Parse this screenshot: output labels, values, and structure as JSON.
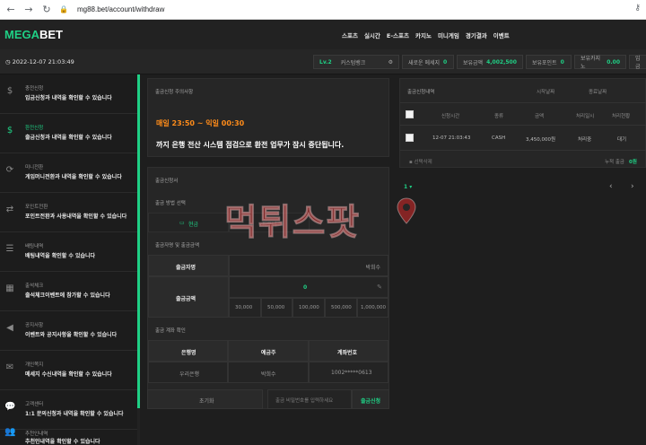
{
  "browser": {
    "url": "mg88.bet/account/withdraw",
    "back_icon": "arrow-left-icon",
    "forward_icon": "arrow-right-icon",
    "reload_icon": "reload-icon"
  },
  "brand": {
    "mega": "MEGA",
    "bet": "BET",
    "accent": "#1fd085"
  },
  "menu": [
    "스포츠",
    "실시간",
    "E-스포츠",
    "카지노",
    "미니게임",
    "경기결과",
    "이벤트"
  ],
  "infobar": {
    "datetime": "2022-12-07 21:03:49",
    "level": "Lv.2",
    "bank": "커스텀뱅크",
    "new_message_label": "새로운 메세지",
    "new_message_count": "0",
    "balance_label": "보유금액",
    "balance_value": "4,002,500",
    "points_label": "보유포인트",
    "points_value": "0",
    "casino_label": "보유카지노",
    "casino_value": "0.00",
    "extra": "입금"
  },
  "sidebar": [
    {
      "title": "충전신청",
      "desc": "입금신청과 내역을 확인할 수 있습니다",
      "icon": "deposit-icon"
    },
    {
      "title": "환전신청",
      "desc": "출금신청과 내역을 확인할 수 있습니다",
      "icon": "withdraw-icon",
      "active": true
    },
    {
      "title": "미니전환",
      "desc": "게임머니전환과 내역을 확인할 수 있습니다",
      "icon": "convert-icon"
    },
    {
      "title": "포인트전환",
      "desc": "포인트전환과 사용내역을 확인할 수 있습니다",
      "icon": "exchange-icon"
    },
    {
      "title": "배팅내역",
      "desc": "배팅내역을 확인할 수 있습니다",
      "icon": "list-icon"
    },
    {
      "title": "출석체크",
      "desc": "출석체크이벤트에 참가할 수 있습니다",
      "icon": "calendar-icon"
    },
    {
      "title": "공지사항",
      "desc": "이벤트와 공지사항을 확인할 수 있습니다",
      "icon": "megaphone-icon"
    },
    {
      "title": "개인쪽지",
      "desc": "메세지 수신내역을 확인할 수 있습니다",
      "icon": "mail-icon"
    },
    {
      "title": "고객센터",
      "desc": "1:1 문의신청과 내역을 확인할 수 있습니다",
      "icon": "chat-icon"
    },
    {
      "title": "추천인내역",
      "desc": "추천인내역을 확인할 수 있습니다",
      "icon": "users-icon"
    }
  ],
  "notice": {
    "head": "출금신청 주의사항",
    "time": "매일 23:50 ~ 익일 00:30",
    "text": "까지 은행 전산 시스템 점검으로 환전 업무가 잠시 중단됩니다."
  },
  "form": {
    "head": "출금신청서",
    "method_label": "출금 방법 선택",
    "method_cash": "현금",
    "method_other": "파트너",
    "section_amount": "출금자명 및 출금금액",
    "name_label": "출금자명",
    "name_value": "박희수",
    "amount_label": "출금금액",
    "amount_value": "0",
    "quick_amounts": [
      "30,000",
      "50,000",
      "100,000",
      "500,000",
      "1,000,000"
    ],
    "section_account": "출금 계좌 확인",
    "col_bank": "은행명",
    "col_holder": "예금주",
    "col_account": "계좌번호",
    "bank_value": "우리은행",
    "holder_value": "박희수",
    "account_value": "1002*****0613",
    "reset_label": "초기화",
    "password_placeholder": "출금 비밀번호를 입력하세요",
    "submit_label": "출금신청"
  },
  "history": {
    "head": "출금신청내역",
    "start_date_label": "시작날짜",
    "end_date_label": "종료날짜",
    "columns": [
      "신청시간",
      "종류",
      "금액",
      "처리일시",
      "처리현황"
    ],
    "rows": [
      {
        "time": "12-07 21:03:43",
        "type": "CASH",
        "amount": "3,450,000원",
        "processed": "처리중",
        "status": "대기"
      }
    ],
    "delete_label": "선택삭제",
    "total_label": "누적 출금",
    "total_value": "0원",
    "page": "1"
  },
  "watermark": {
    "text": "먹튀스팟"
  }
}
